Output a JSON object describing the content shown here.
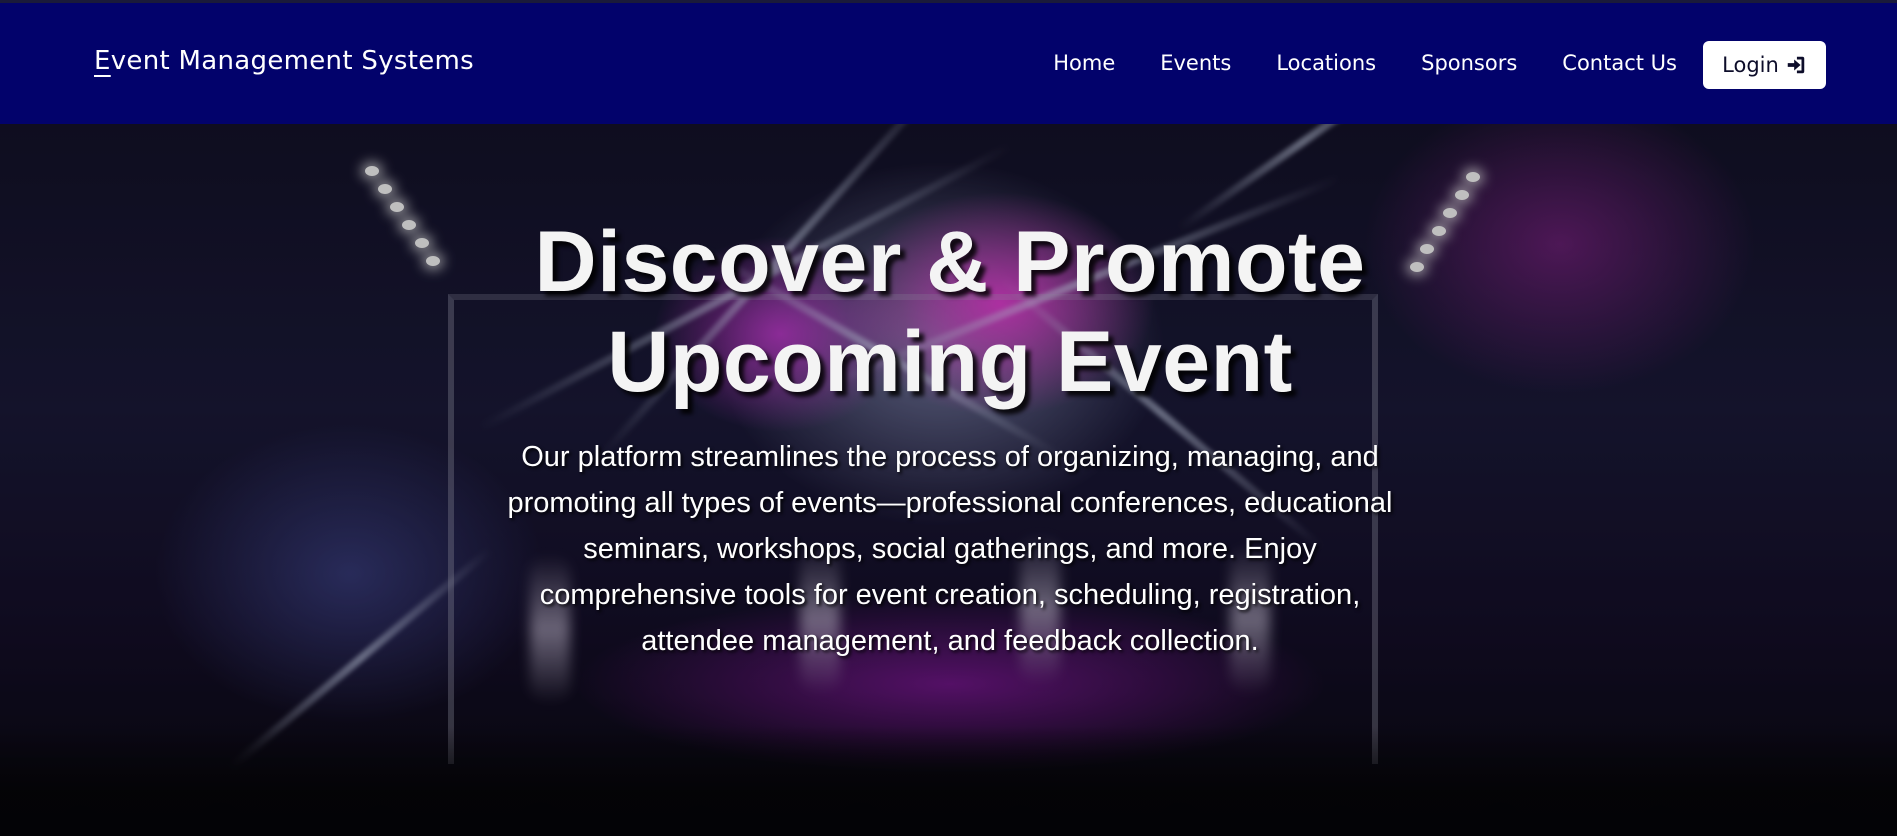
{
  "navbar": {
    "brand": "Event Management Systems",
    "links": [
      "Home",
      "Events",
      "Locations",
      "Sponsors",
      "Contact Us"
    ],
    "login_label": "Login",
    "colors": {
      "background": "#02026b",
      "text": "#ffffff",
      "login_bg": "#ffffff"
    }
  },
  "hero": {
    "title_line1": "Discover & Promote",
    "title_line2": "Upcoming Event",
    "description": "Our platform streamlines the process of organizing, managing, and promoting all types of events—professional conferences, educational seminars, workshops, social gatherings, and more. Enjoy comprehensive tools for event creation, scheduling, registration, attendee management, and feedback collection.",
    "background_image": "concert-stage-photo"
  },
  "icons": {
    "login": "sign-in-icon"
  }
}
